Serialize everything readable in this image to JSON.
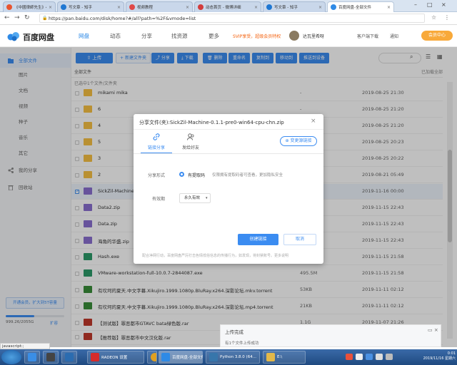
{
  "browser": {
    "tabs": [
      {
        "title": "《中國律師先生》41",
        "color": "#e8542f",
        "active": false
      },
      {
        "title": "写文章 - 知乎",
        "color": "#1f77d2",
        "active": false
      },
      {
        "title": "视频教程",
        "color": "#e04848",
        "active": false
      },
      {
        "title": "动态首页 - 微博详细",
        "color": "#d33c3c",
        "active": false
      },
      {
        "title": "写文章 - 知乎",
        "color": "#1f77d2",
        "active": false
      },
      {
        "title": "百度网盘-全部文件",
        "color": "#2e8ae6",
        "active": true
      }
    ],
    "url": "https://pan.baidu.com/disk/home?#/all?path=%2F&vmode=list"
  },
  "header": {
    "logo": "百度网盘",
    "nav": [
      "网盘",
      "动态",
      "分享",
      "找资源",
      "更多"
    ],
    "svip": "SVIP享受，超级会员特权",
    "username": "达瓦里希呀",
    "links": [
      "客户端下载",
      "通知"
    ],
    "member_button": "会员中心"
  },
  "sidebar": {
    "items": [
      {
        "label": "全部文件",
        "icon": "folder-icon"
      },
      {
        "label": "图片",
        "icon": "none"
      },
      {
        "label": "文档",
        "icon": "none"
      },
      {
        "label": "视频",
        "icon": "none"
      },
      {
        "label": "种子",
        "icon": "none"
      },
      {
        "label": "音乐",
        "icon": "none"
      },
      {
        "label": "其它",
        "icon": "none"
      },
      {
        "label": "我的分享",
        "icon": "share-icon"
      },
      {
        "label": "回收站",
        "icon": "trash-icon"
      }
    ],
    "promo": "开通会员，扩大到5T容量",
    "quota": "999.26/2055G",
    "quota_fraction": 0.486,
    "expand": "扩容"
  },
  "toolbar": {
    "upload": "上传",
    "buttons": [
      "新建文件夹",
      "分享",
      "下载",
      "删除",
      "重命名",
      "复制到",
      "移动到",
      "推送到设备"
    ]
  },
  "list": {
    "breadcrumb": "全部文件",
    "loaded": "已加载全部",
    "selected_info": "已选中1个文件/文件夹",
    "rows": [
      {
        "name": "mikami mika",
        "size": "-",
        "date": "2019-08-25 21:30",
        "type": "folder",
        "selected": false
      },
      {
        "name": "6",
        "size": "-",
        "date": "2019-08-25 21:20",
        "type": "folder",
        "selected": false
      },
      {
        "name": "4",
        "size": "-",
        "date": "2019-08-25 21:20",
        "type": "folder",
        "selected": false
      },
      {
        "name": "5",
        "size": "-",
        "date": "2019-08-25 20:23",
        "type": "folder",
        "selected": false
      },
      {
        "name": "3",
        "size": "-",
        "date": "2019-08-25 20:22",
        "type": "folder",
        "selected": false
      },
      {
        "name": "2",
        "size": "-",
        "date": "2019-08-21 05:49",
        "type": "folder",
        "selected": false
      },
      {
        "name": "SickZil-Machine-0...",
        "size": "",
        "date": "2019-11-16 00:00",
        "type": "zip",
        "selected": true
      },
      {
        "name": "Data2.zip",
        "size": "",
        "date": "2019-11-15 22:43",
        "type": "zip",
        "selected": false
      },
      {
        "name": "Data.zip",
        "size": "",
        "date": "2019-11-15 22:43",
        "type": "zip",
        "selected": false
      },
      {
        "name": "海角的华盛.zip",
        "size": "",
        "date": "2019-11-15 22:43",
        "type": "zip",
        "selected": false
      },
      {
        "name": "Hash.exe",
        "size": "",
        "date": "2019-11-15 21:58",
        "type": "exe",
        "selected": false
      },
      {
        "name": "VMware-workstation-full-10.0.7-2844087.exe",
        "size": "495.5M",
        "date": "2019-11-15 21:58",
        "type": "exe",
        "selected": false
      },
      {
        "name": "有坎坷的夏天.中文字幕.Xikujiro.1999.1080p.BluRay.x264.深影论坛.mkv.torrent",
        "size": "53KB",
        "date": "2019-11-11 02:12",
        "type": "torrent",
        "selected": false
      },
      {
        "name": "有坎坷的夏天.中文字幕.Xikujiro.1999.1080p.BluRay.x264.深影论坛.mp4.torrent",
        "size": "21KB",
        "date": "2019-11-11 02:12",
        "type": "torrent",
        "selected": false
      },
      {
        "name": "【测试版】罪恶都市GTAVC bata绿色版.rar",
        "size": "1.1G",
        "date": "2019-11-07 21:26",
        "type": "rar",
        "selected": false
      },
      {
        "name": "【推荐版】罪恶都市中文汉化版.rar",
        "size": "",
        "date": "",
        "type": "rar",
        "selected": false
      }
    ]
  },
  "modal": {
    "title": "分享文件(夹):SickZil-Machine-0.1.1-pre0-win64-cpu-chn.zip",
    "tabs": [
      "链接分享",
      "发给好友"
    ],
    "change_button": "变更源链接",
    "share_form_label": "分享形式",
    "share_form_value": "有提取码",
    "share_form_desc": "仅限拥有提取码者可查看，更加隐私安全",
    "period_label": "有效期",
    "period_value": "永久有效",
    "create_button": "创建链接",
    "cancel_button": "取消",
    "footnote": "配合净网行动，百度网盘严厉打击色情低俗信息的传播行为，如发现，将封禁账号。更多说明"
  },
  "upload_panel": {
    "title": "上传完成",
    "subtitle": "有1个文件上传成功"
  },
  "statusbar": "javascript:;",
  "taskbar": {
    "items": [
      {
        "label": "",
        "color": "#3a8ee6"
      },
      {
        "label": "",
        "color": "#444"
      },
      {
        "label": "",
        "color": "#2b6cb0"
      },
      {
        "label": "RADEON 设置",
        "color": "#d62b2b"
      },
      {
        "label": "",
        "color": "#e0a020"
      },
      {
        "label": "百度网盘-全部文件",
        "color": "#2e8ae6"
      },
      {
        "label": "Python 3.8.0 (64...",
        "color": "#3776ab"
      },
      {
        "label": "E:\\",
        "color": "#e2b84a"
      }
    ],
    "time": "0:01",
    "date": "2019/11/16 星期六"
  }
}
